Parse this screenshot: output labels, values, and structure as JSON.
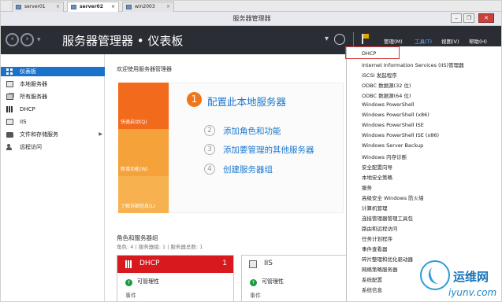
{
  "vm_tabs": [
    {
      "label": "server01",
      "active": false
    },
    {
      "label": "server02",
      "active": true
    },
    {
      "label": "win2003",
      "active": false
    }
  ],
  "window": {
    "title": "服务器管理器"
  },
  "header": {
    "breadcrumb": "服务器管理器 • 仪表板",
    "menus": [
      {
        "label": "管理(M)",
        "active": false
      },
      {
        "label": "工具(T)",
        "active": true
      },
      {
        "label": "视图(V)",
        "active": false
      },
      {
        "label": "帮助(H)",
        "active": false
      }
    ]
  },
  "sidebar": {
    "items": [
      {
        "label": "仪表板",
        "icon": "dashboard-icon",
        "active": true
      },
      {
        "label": "本地服务器",
        "icon": "server-icon",
        "active": false
      },
      {
        "label": "所有服务器",
        "icon": "servers-icon",
        "active": false
      },
      {
        "label": "DHCP",
        "icon": "dhcp-icon",
        "active": false
      },
      {
        "label": "IIS",
        "icon": "iis-icon",
        "active": false
      },
      {
        "label": "文件和存储服务",
        "icon": "folder-icon",
        "active": false,
        "has_chevron": true
      },
      {
        "label": "远程访问",
        "icon": "remote-access-icon",
        "active": false
      }
    ]
  },
  "main": {
    "welcome_title": "欢迎使用服务器管理器",
    "tiles": [
      {
        "label": "快速启动(Q)"
      },
      {
        "label": "新增功能(W)"
      },
      {
        "label": "了解详细信息(L)"
      }
    ],
    "step1": {
      "number": "1",
      "text": "配置此本地服务器"
    },
    "steps": [
      {
        "number": "2",
        "text": "添加角色和功能"
      },
      {
        "number": "3",
        "text": "添加要管理的其他服务器"
      },
      {
        "number": "4",
        "text": "创建服务器组"
      }
    ],
    "roles_title": "角色和服务器组",
    "roles_subtitle": "角色: 4 | 服务器组: 1 | 服务器总数: 1",
    "cards": [
      {
        "name": "DHCP",
        "count": "1",
        "manageability": "可管理性",
        "next": "事件"
      },
      {
        "name": "IIS",
        "count": "",
        "manageability": "可管理性",
        "next": "事件"
      }
    ]
  },
  "tools_menu": {
    "items": [
      "DHCP",
      "Internet Information Services (IIS)管理器",
      "iSCSI 发起程序",
      "ODBC 数据源(32 位)",
      "ODBC 数据源(64 位)",
      "Windows PowerShell",
      "Windows PowerShell (x86)",
      "Windows PowerShell ISE",
      "Windows PowerShell ISE (x86)",
      "Windows Server Backup",
      "Windows 内存诊断",
      "安全配置向导",
      "本地安全策略",
      "服务",
      "高级安全 Windows 防火墙",
      "计算机管理",
      "连接管理器管理工具包",
      "路由和远程访问",
      "任务计划程序",
      "事件查看器",
      "碎片整理和优化驱动器",
      "网络策略服务器",
      "系统配置",
      "系统信息"
    ]
  },
  "watermark": {
    "cn": "运维网",
    "en": "iyunv.com"
  },
  "colors": {
    "header_bg": "#2b2d35",
    "accent_blue": "#1a73c9",
    "tile_orange": "#f26a1b",
    "dhcp_red": "#d81a1f",
    "link_blue": "#1b78cf"
  }
}
